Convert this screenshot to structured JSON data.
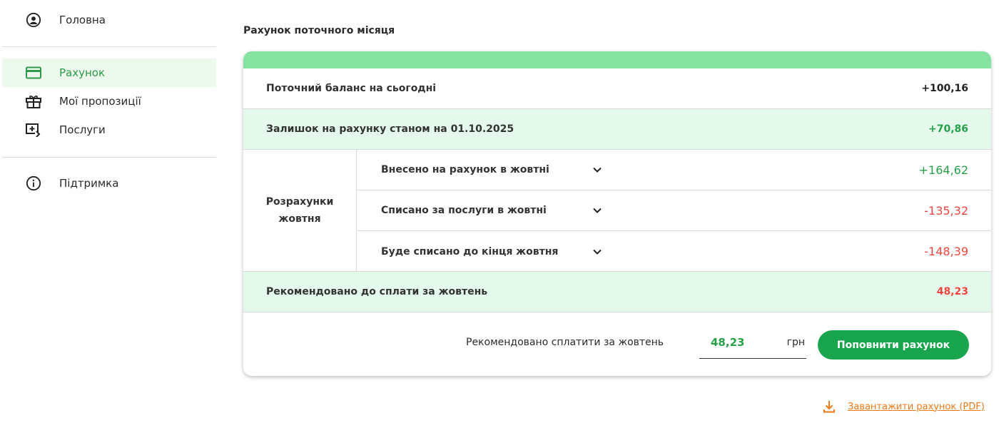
{
  "sidebar": {
    "items": [
      {
        "label": "Головна",
        "icon": "user-circle-icon"
      },
      {
        "label": "Рахунок",
        "icon": "credit-card-icon",
        "active": true
      },
      {
        "label": "Мої пропозиції",
        "icon": "gift-icon"
      },
      {
        "label": "Послуги",
        "icon": "add-screen-icon"
      },
      {
        "label": "Підтримка",
        "icon": "info-icon"
      }
    ]
  },
  "main": {
    "title": "Рахунок поточного місяця",
    "balance": {
      "label": "Поточний баланс на сьогодні",
      "value": "+100,16"
    },
    "remainder": {
      "label": "Залишок на рахунку станом на 01.10.2025",
      "value": "+70,86"
    },
    "settlements": {
      "label": "Розрахунки жовтня",
      "rows": [
        {
          "label": "Внесено на рахунок в жовтні",
          "value": "+164,62"
        },
        {
          "label": "Списано за послуги в жовтні",
          "value": "-135,32"
        },
        {
          "label": "Буде списано до кінця жовтня",
          "value": "-148,39"
        }
      ]
    },
    "recommended": {
      "label": "Рекомендовано до сплати за жовтень",
      "value": "48,23"
    },
    "payment": {
      "label": "Рекомендовано сплатити за жовтень",
      "amount": "48,23",
      "currency": "грн",
      "button": "Поповнити рахунок"
    },
    "download": "Завантажити рахунок (PDF)"
  },
  "colors": {
    "accent_green": "#19a54e",
    "band_green": "#84e3a0",
    "tint_green": "#e4f8ec",
    "negative_red": "#f0463f",
    "link_orange": "#f07a1a"
  }
}
